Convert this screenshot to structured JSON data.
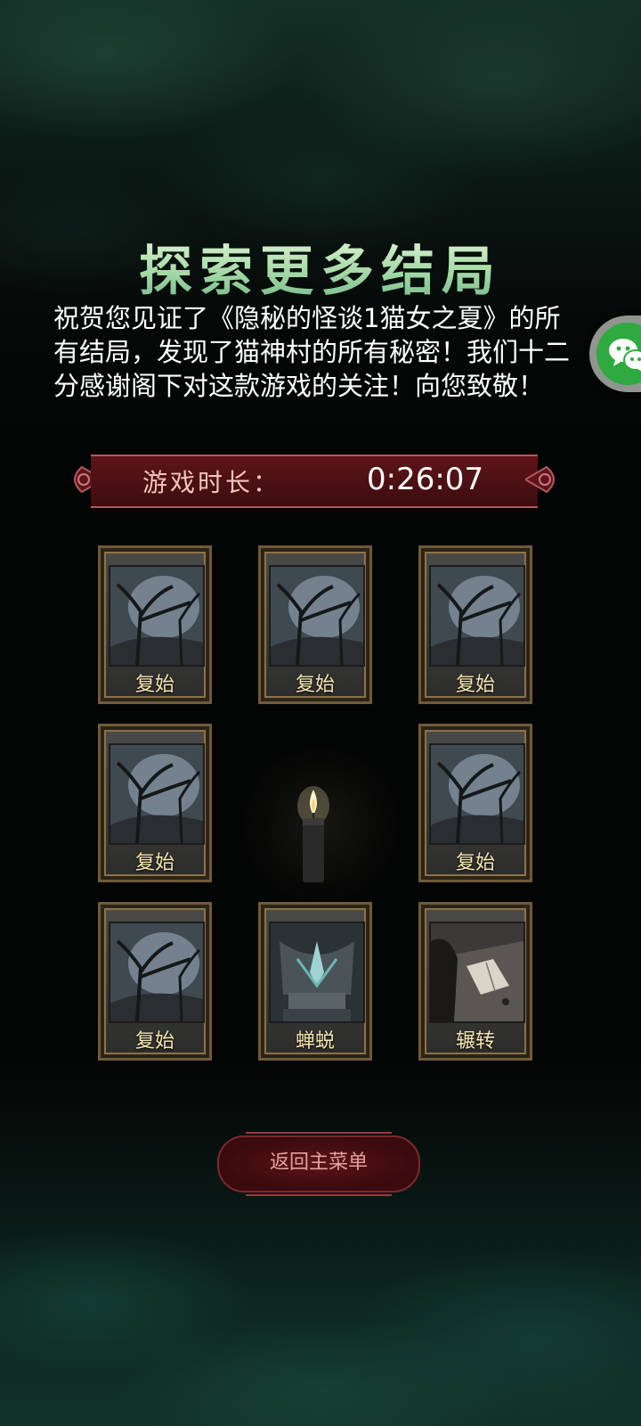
{
  "title": "探索更多结局",
  "message": "祝贺您见证了《隐秘的怪谈1猫女之夏》的所有结局，发现了猫神村的所有秘密！我们十二分感谢阁下对这款游戏的关注！向您致敬！",
  "playtime": {
    "label": "游戏时长：",
    "value": "0:26:07"
  },
  "endings": [
    {
      "label": "复始",
      "art": "forest"
    },
    {
      "label": "复始",
      "art": "forest"
    },
    {
      "label": "复始",
      "art": "forest"
    },
    {
      "label": "复始",
      "art": "forest"
    },
    {
      "label": "复始",
      "art": "forest"
    },
    {
      "label": "复始",
      "art": "forest"
    },
    {
      "label": "蝉蜕",
      "art": "throne"
    },
    {
      "label": "辗转",
      "art": "book"
    }
  ],
  "menu_button": "返回主菜单",
  "icons": {
    "share": "wechat-icon",
    "center": "candle-icon"
  },
  "colors": {
    "title": "#cdeec1",
    "banner": "#5e1519",
    "card_label": "#f7e6b0",
    "menu_text": "#e5a09a"
  }
}
